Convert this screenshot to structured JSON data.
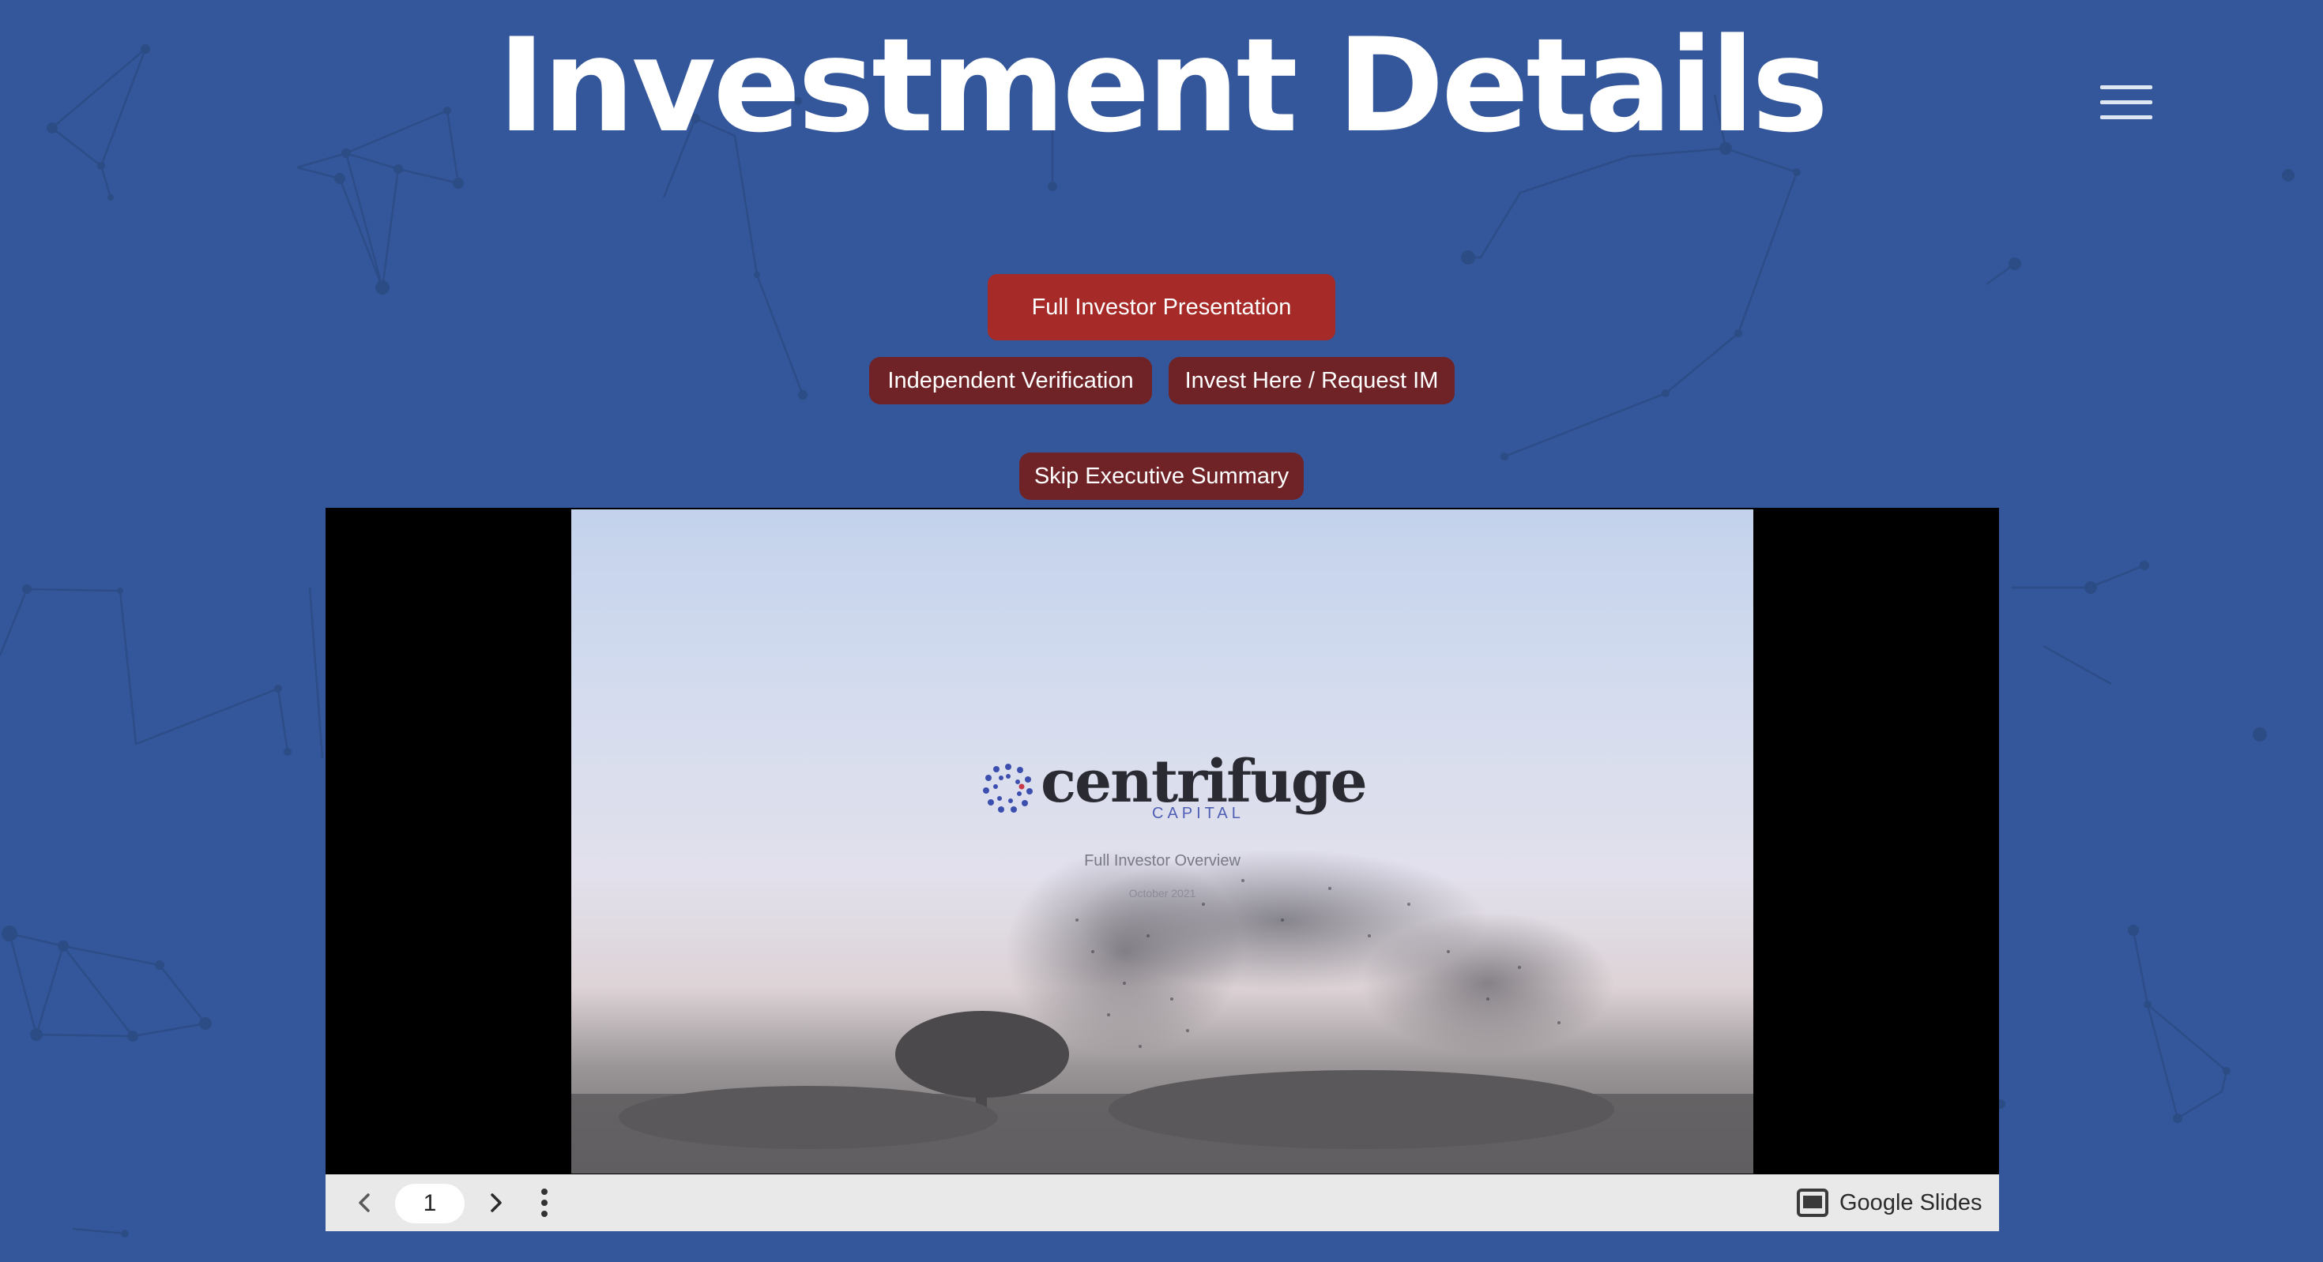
{
  "page": {
    "title": "Investment Details",
    "background_color": "#34579b"
  },
  "header": {
    "menu_icon": "hamburger-menu-icon"
  },
  "buttons": {
    "full_presentation": "Full Investor Presentation",
    "independent_verification": "Independent Verification",
    "invest_request": "Invest Here / Request IM",
    "skip_summary": "Skip Executive Summary",
    "primary_color": "#a52a28",
    "secondary_color": "#6f2327"
  },
  "slide": {
    "brand_name": "centrifuge",
    "brand_sub": "CAPITAL",
    "subtitle": "Full Investor Overview",
    "date": "October 2021"
  },
  "viewer": {
    "current_page": "1",
    "prev_icon": "chevron-left-icon",
    "next_icon": "chevron-right-icon",
    "more_icon": "more-vertical-icon",
    "brand_icon": "slides-icon",
    "brand_label": "Google Slides"
  }
}
